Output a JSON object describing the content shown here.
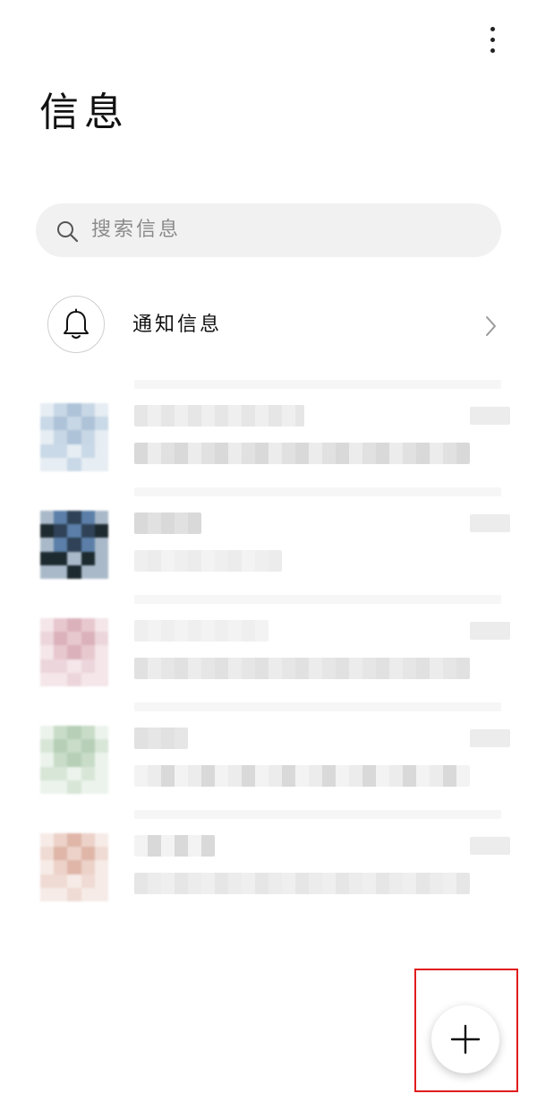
{
  "header": {
    "title": "信息",
    "more_icon": "more-vertical-icon"
  },
  "search": {
    "placeholder": "搜索信息",
    "icon": "search-icon"
  },
  "notification": {
    "label": "通知信息",
    "icon": "bell-icon",
    "chevron_icon": "chevron-right-icon"
  },
  "conversations": [
    {
      "avatar_colors": [
        "#c7d7e6",
        "#aec3d8",
        "#c9d9e7",
        "#e6edf3"
      ],
      "blurred": true
    },
    {
      "avatar_colors": [
        "#5b7fa8",
        "#2f4257",
        "#1d2a30",
        "#a9b9c9"
      ],
      "blurred": true
    },
    {
      "avatar_colors": [
        "#e8c8cf",
        "#dbb2bc",
        "#ecd6db",
        "#f4e6e9"
      ],
      "blurred": true
    },
    {
      "avatar_colors": [
        "#c8dcc8",
        "#b6cfb6",
        "#d7e6d7",
        "#ecf3ec"
      ],
      "blurred": true
    },
    {
      "avatar_colors": [
        "#ecd2c9",
        "#dfb6a8",
        "#efdbd3",
        "#f6ebe7"
      ],
      "blurred": true
    }
  ],
  "fab": {
    "icon": "plus-icon"
  },
  "colors": {
    "background": "#ffffff",
    "search_bg": "#f1f1f1",
    "highlight": "#e11d1d"
  }
}
